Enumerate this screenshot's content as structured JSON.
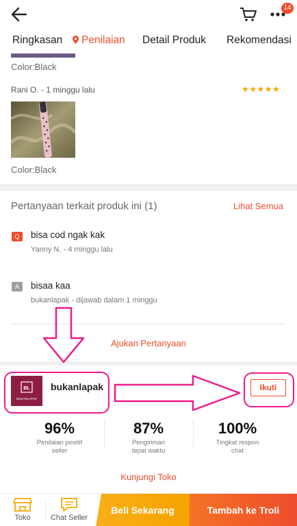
{
  "header": {
    "back_icon": "arrow-left-icon",
    "cart_icon": "cart-icon",
    "more_icon": "more-dots-icon",
    "notification_badge": "14"
  },
  "tabs": [
    {
      "label": "Ringkasan"
    },
    {
      "label": "Penilaian",
      "icon": "location-pin-icon"
    },
    {
      "label": "Detail Produk"
    },
    {
      "label": "Rekomendasi"
    }
  ],
  "reviews": {
    "prev_color": "Color:Black",
    "item": {
      "reviewer": "Rani O. - 1  minggu lalu",
      "stars": "★★★★★",
      "color": "Color:Black"
    }
  },
  "qa": {
    "title": "Pertanyaan terkait produk ini (1)",
    "see_all": "Lihat Semua",
    "question_badge": "Q",
    "question": "bisa cod ngak kak",
    "question_meta": "Yanny N. - 4  minggu lalu",
    "answer_badge": "A",
    "answer": "bisaa kaa",
    "answer_meta": "bukanlapak - dijawab dalam 1 minggu",
    "ask_button": "Ajukan Pertanyaan"
  },
  "shop": {
    "logo_text": "BL",
    "logo_caption": "BUKANLAPAK",
    "name": "bukanlapak",
    "follow_button": "Ikuti",
    "stats": [
      {
        "value": "96%",
        "label_line1": "Penilaian positif",
        "label_line2": "seller"
      },
      {
        "value": "87%",
        "label_line1": "Pengiriman",
        "label_line2": "tepat waktu"
      },
      {
        "value": "100%",
        "label_line1": "Tingkat respon",
        "label_line2": "chat"
      }
    ],
    "visit_button": "Kunjungi Toko"
  },
  "bottom_bar": {
    "store_label": "Toko",
    "chat_label": "Chat Seller",
    "buy_now": "Beli Sekarang",
    "add_to_cart": "Tambah ke Troli"
  },
  "colors": {
    "accent": "#ee4d2d",
    "highlight": "#ee1b8a",
    "stars": "#f6a700",
    "buy_now": "#f9ae18",
    "shop_logo": "#8e1d43"
  }
}
